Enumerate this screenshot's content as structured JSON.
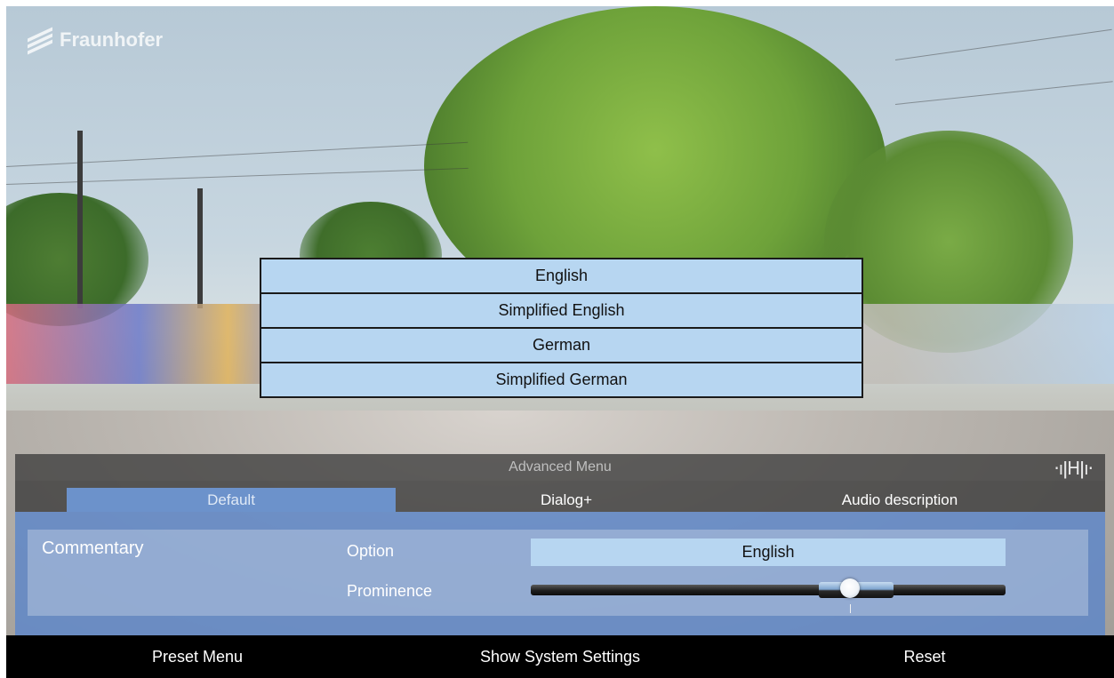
{
  "brand": {
    "name": "Fraunhofer"
  },
  "dropdown": {
    "options": [
      "English",
      "Simplified English",
      "German",
      "Simplified German"
    ]
  },
  "advanced_menu": {
    "title": "Advanced Menu",
    "logo_icon": "hearing-wave-icon",
    "tabs": [
      {
        "label": "Default",
        "active": true
      },
      {
        "label": "Dialog+",
        "active": false
      },
      {
        "label": "Audio description",
        "active": false
      }
    ],
    "section": {
      "title": "Commentary",
      "option_label": "Option",
      "option_value": "English",
      "prominence_label": "Prominence",
      "prominence_level": 0.68
    }
  },
  "bottom_bar": {
    "preset": "Preset Menu",
    "system": "Show System Settings",
    "reset": "Reset"
  },
  "colors": {
    "dropdown_item_bg": "#b7d6f1",
    "panel_blue": "#5f87c8",
    "bottom_bar_bg": "#000000"
  }
}
